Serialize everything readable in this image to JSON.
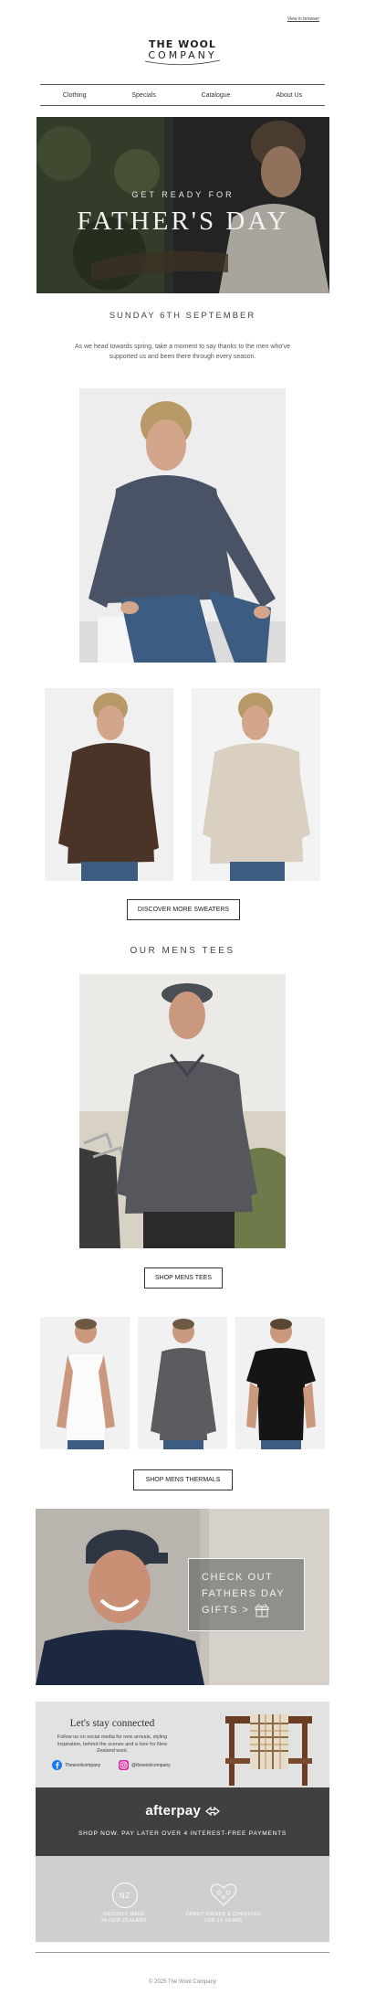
{
  "header": {
    "view_in_browser": "View in browser",
    "logo_line1": "THE WOOL",
    "logo_line2": "COMPANY"
  },
  "nav": {
    "items": [
      {
        "label": "Clothing"
      },
      {
        "label": "Specials"
      },
      {
        "label": "Catalogue"
      },
      {
        "label": "About Us"
      }
    ]
  },
  "hero": {
    "pre_title": "GET READY FOR",
    "title": "FATHER'S DAY"
  },
  "intro": {
    "date": "SUNDAY 6TH SEPTEMBER",
    "body": "As we head towards spring, take a moment to say thanks to the men who've supported us and been there through every season."
  },
  "sweaters": {
    "button_label": "DISCOVER MORE SWEATERS"
  },
  "tees": {
    "title": "OUR MENS TEES",
    "button_label": "SHOP MENS TEES"
  },
  "thermals": {
    "button_label": "SHOP MENS THERMALS"
  },
  "gifts": {
    "line1": "CHECK OUT",
    "line2": "FATHERS DAY",
    "line3": "GIFTS >"
  },
  "social": {
    "title": "Let's stay connected",
    "body": "Follow us on social media for new arrivals, styling inspiration, behind the scenes and a love for New Zealand wool.",
    "facebook_handle": "Thewoolcompany",
    "instagram_handle": "@thewoolcompany"
  },
  "afterpay": {
    "logo": "afterpay",
    "tagline": "SHOP NOW. PAY LATER OVER 4 INTEREST-FREE PAYMENTS"
  },
  "badges": {
    "nz_mark": "NZ",
    "made_line1": "PROUDLY MADE",
    "made_line2": "IN NEW ZEALAND",
    "family_line1": "FAMILY OWNED & OPERATED",
    "family_line2": "FOR 15 YEARS"
  },
  "footer": {
    "copyright": "© 2025 The Wool Company"
  },
  "colors": {
    "hero_bg": "#2e3530",
    "afterpay_bg": "#404040",
    "badge_bg": "#cfcfcf",
    "social_bg": "#e2e2e2"
  }
}
